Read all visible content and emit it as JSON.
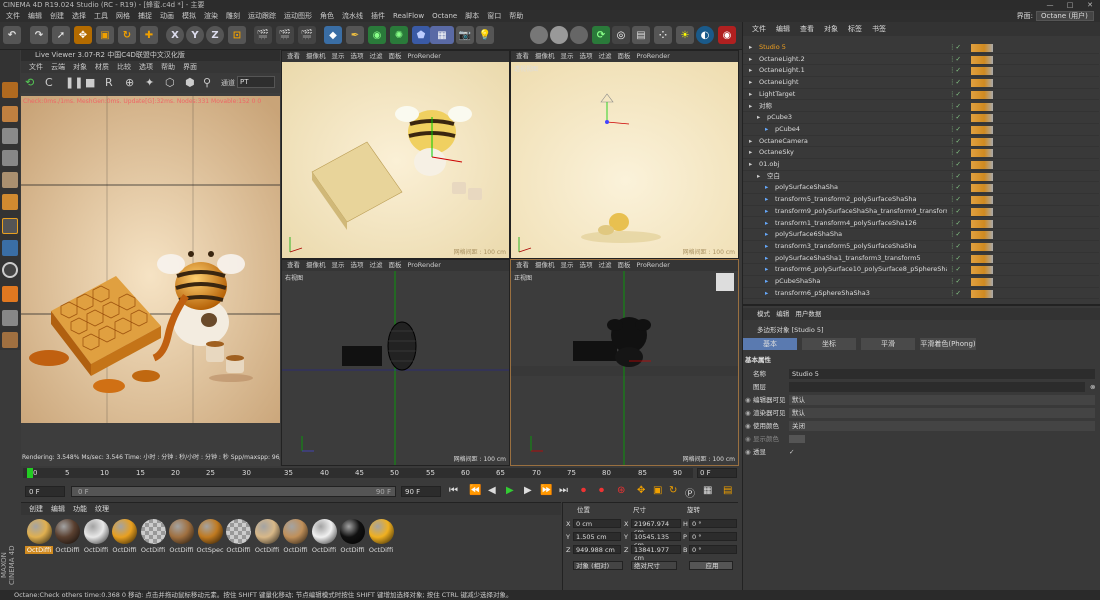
{
  "title": "CINEMA 4D R19.024 Studio (RC - R19) - [蜂蜜.c4d *] - 主要",
  "window_controls": [
    "—",
    "□",
    "✕"
  ],
  "menubar": [
    "文件",
    "编辑",
    "创建",
    "选择",
    "工具",
    "网格",
    "捕捉",
    "动画",
    "模拟",
    "渲染",
    "雕刻",
    "运动跟踪",
    "运动图形",
    "角色",
    "流水线",
    "插件",
    "RealFlow",
    "Octane",
    "脚本",
    "窗口",
    "帮助"
  ],
  "layout": {
    "label": "界面:",
    "value": "Octane (用户)"
  },
  "live_viewer": {
    "title": "Live Viewer 3.07-R2 中国C4D联盟中文汉化版",
    "menu": [
      "文件",
      "云端",
      "对象",
      "材质",
      "比较",
      "选项",
      "帮助",
      "界面"
    ],
    "channel_label": "通道",
    "channel_value": "PT",
    "stats": "Check:0ms./1ms. MeshGen:0ms. Update[G]:32ms. Nodes:331 Movable:152  0 0",
    "render_status": "Rendering: 3.548%  Ms/sec: 3.546    Time: 小时 : 分钟 : 秒/小时 : 分钟 : 秒   Spp/maxspp: 96/2"
  },
  "viewports": [
    {
      "menu": [
        "查看",
        "摄像机",
        "显示",
        "选项",
        "过滤",
        "面板",
        "ProRender"
      ],
      "label": "",
      "grid": "网格间距 : 100 cm"
    },
    {
      "menu": [
        "查看",
        "摄像机",
        "显示",
        "选项",
        "过滤",
        "面板",
        "ProRender"
      ],
      "label": "透视视图",
      "grid": "网格间距 : 100 cm"
    },
    {
      "menu": [
        "查看",
        "摄像机",
        "显示",
        "选项",
        "过滤",
        "面板",
        "ProRender"
      ],
      "label": "右视图",
      "grid": "网格间距 : 100 cm"
    },
    {
      "menu": [
        "查看",
        "摄像机",
        "显示",
        "选项",
        "过滤",
        "面板",
        "ProRender"
      ],
      "label": "正视图",
      "grid": "网格间距 : 100 cm"
    }
  ],
  "timeline": {
    "ticks": [
      "0",
      "5",
      "10",
      "15",
      "20",
      "25",
      "30",
      "35",
      "40",
      "45",
      "50",
      "55",
      "60",
      "65",
      "70",
      "75",
      "80",
      "85",
      "90"
    ],
    "current_frame": "0 F",
    "start": "0 F",
    "range_start": "0 F",
    "range_end": "90 F",
    "end": "90 F"
  },
  "materials": {
    "menu": [
      "创建",
      "编辑",
      "功能",
      "纹理"
    ],
    "items": [
      {
        "name": "OctDiffi",
        "color": "#e0b050",
        "selected": true
      },
      {
        "name": "OctDiffi",
        "color": "#5a4030"
      },
      {
        "name": "OctDiffi",
        "color": "#e8e8e8"
      },
      {
        "name": "OctDiffi",
        "color": "#e8a020"
      },
      {
        "name": "OctDiffi",
        "color": "checker"
      },
      {
        "name": "OctDiffi",
        "color": "#a07040"
      },
      {
        "name": "OctSpec",
        "color": "#c07a20"
      },
      {
        "name": "OctDiffi",
        "color": "checker"
      },
      {
        "name": "OctDiffi",
        "color": "#d8b888"
      },
      {
        "name": "OctDiffi",
        "color": "#c0905a"
      },
      {
        "name": "OctDiffi",
        "color": "#f0f0f0"
      },
      {
        "name": "OctDiffi",
        "color": "#111111"
      },
      {
        "name": "OctDiffi",
        "color": "#f0b020"
      }
    ]
  },
  "coords": {
    "headers": [
      "位置",
      "尺寸",
      "旋转"
    ],
    "rows": [
      {
        "axis": "X",
        "pos": "0 cm",
        "size_axis": "X",
        "size": "21967.974 cm",
        "rot_axis": "H",
        "rot": "0 °"
      },
      {
        "axis": "Y",
        "pos": "1.505 cm",
        "size_axis": "Y",
        "size": "10545.135 cm",
        "rot_axis": "P",
        "rot": "0 °"
      },
      {
        "axis": "Z",
        "pos": "949.988 cm",
        "size_axis": "Z",
        "size": "13841.977 cm",
        "rot_axis": "B",
        "rot": "0 °"
      }
    ],
    "mode1": "对象 (相对)",
    "mode2": "绝对尺寸",
    "apply": "应用"
  },
  "object_manager": {
    "menu": [
      "文件",
      "编辑",
      "查看",
      "对象",
      "标签",
      "书签"
    ],
    "items": [
      {
        "name": "Studio 5",
        "indent": 0,
        "selected": true
      },
      {
        "name": "OctaneLight.2",
        "indent": 0
      },
      {
        "name": "OctaneLight.1",
        "indent": 0
      },
      {
        "name": "OctaneLight",
        "indent": 0
      },
      {
        "name": "LightTarget",
        "indent": 0
      },
      {
        "name": "对称",
        "indent": 0
      },
      {
        "name": "pCube3",
        "indent": 1
      },
      {
        "name": "pCube4",
        "indent": 2
      },
      {
        "name": "OctaneCamera",
        "indent": 0
      },
      {
        "name": "OctaneSky",
        "indent": 0
      },
      {
        "name": "01.obj",
        "indent": 0
      },
      {
        "name": "空白",
        "indent": 1
      },
      {
        "name": "polySurfaceShaSha",
        "indent": 2
      },
      {
        "name": "transform5_transform2_polySurfaceShaSha",
        "indent": 2
      },
      {
        "name": "transform9_polySurfaceShaSha_transform9_transform2",
        "indent": 2
      },
      {
        "name": "transform1_transform4_polySurfaceSha126",
        "indent": 2
      },
      {
        "name": "polySurface6ShaSha",
        "indent": 2
      },
      {
        "name": "transform3_transform5_polySurfaceShaSha",
        "indent": 2
      },
      {
        "name": "polySurfaceShaSha1_transform3_transform5",
        "indent": 2
      },
      {
        "name": "transform6_polySurface10_polySurface8_pSphereShaSha2",
        "indent": 2
      },
      {
        "name": "pCubeShaSha",
        "indent": 2
      },
      {
        "name": "transform6_pSphereShaSha3",
        "indent": 2
      }
    ]
  },
  "attribute_manager": {
    "menu": [
      "模式",
      "编辑",
      "用户数据"
    ],
    "object_label": "多边形对象 [Studio 5]",
    "tabs": [
      "基本",
      "坐标",
      "平滑",
      "平滑着色(Phong)"
    ],
    "section": "基本属性",
    "fields": [
      {
        "label": "名称",
        "value": "Studio 5"
      },
      {
        "label": "图层",
        "value": ""
      },
      {
        "label": "编辑器可见",
        "value": "默认"
      },
      {
        "label": "渲染器可见",
        "value": "默认"
      },
      {
        "label": "使用颜色",
        "value": "关闭"
      },
      {
        "label": "显示颜色",
        "value": ""
      },
      {
        "label": "透显",
        "value": ""
      }
    ]
  },
  "statusbar": "Octane:Check others time:0.368  0    移动: 点击并拖动鼠标移动元素。按住 SHIFT 键量化移动; 节点编辑模式时按住 SHIFT 键增加选择对象; 按住 CTRL 键减少选择对象。",
  "brand": "MAXON CINEMA 4D"
}
